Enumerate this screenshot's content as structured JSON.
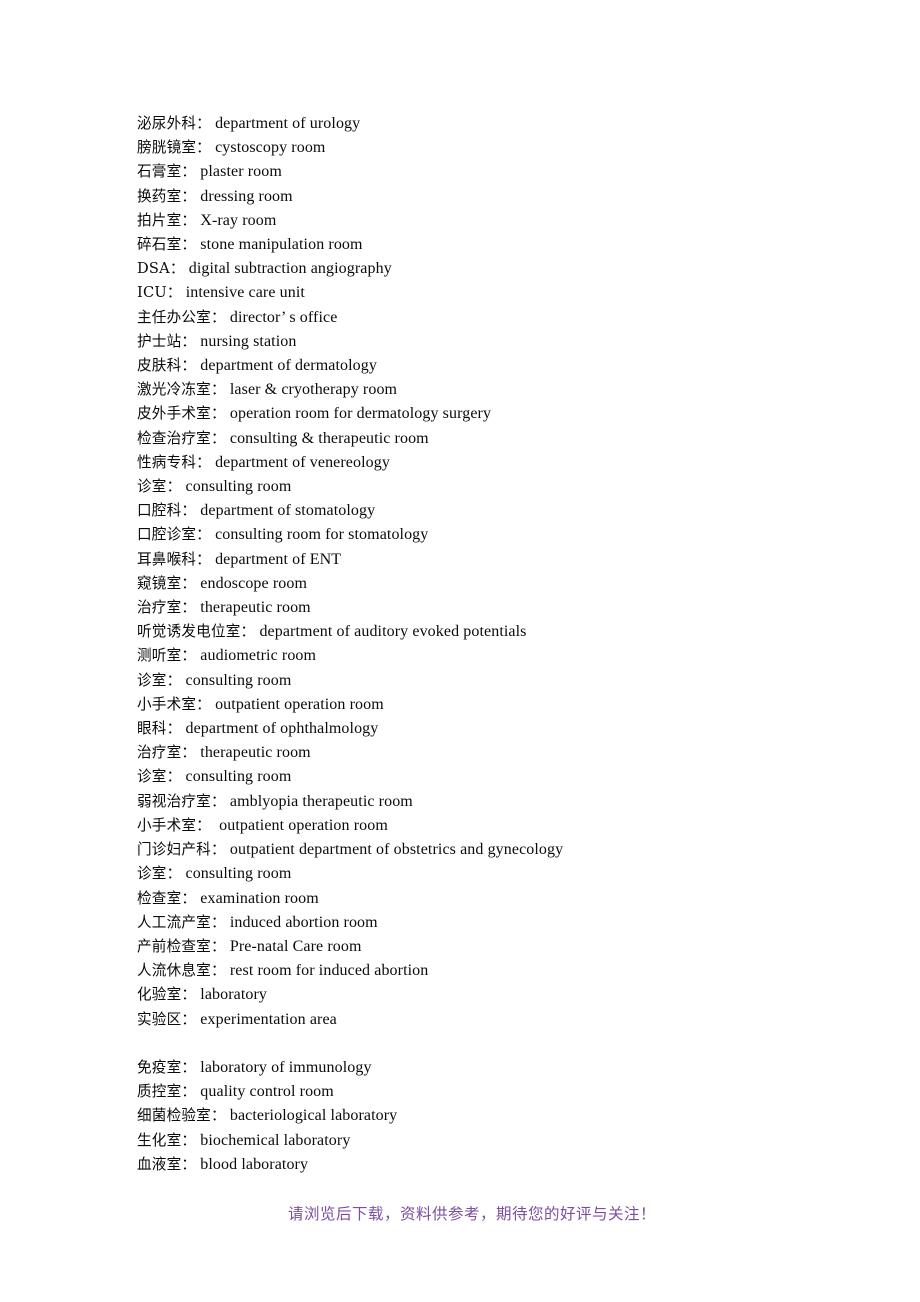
{
  "document": {
    "text_color": "#0b0b0b",
    "footer_color": "#7b4fa0",
    "background_color": "#ffffff"
  },
  "lines": [
    {
      "cn": "泌尿外科：",
      "en": " department of urology"
    },
    {
      "cn": "膀胱镜室：",
      "en": " cystoscopy room"
    },
    {
      "cn": "石膏室：",
      "en": " plaster room"
    },
    {
      "cn": "换药室：",
      "en": " dressing room"
    },
    {
      "cn": "拍片室：",
      "en": " X-ray room"
    },
    {
      "cn": "碎石室：",
      "en": " stone manipulation room"
    },
    {
      "cn": "DSA：",
      "en": " digital subtraction angiography"
    },
    {
      "cn": "ICU：",
      "en": " intensive care unit"
    },
    {
      "cn": "主任办公室：",
      "en": " director’ s office"
    },
    {
      "cn": "护士站：",
      "en": " nursing station"
    },
    {
      "cn": "皮肤科：",
      "en": " department of dermatology"
    },
    {
      "cn": "激光冷冻室：",
      "en": " laser & cryotherapy room"
    },
    {
      "cn": "皮外手术室：",
      "en": " operation room for dermatology surgery"
    },
    {
      "cn": "检查治疗室：",
      "en": " consulting & therapeutic room"
    },
    {
      "cn": "性病专科：",
      "en": " department of venereology"
    },
    {
      "cn": "诊室：",
      "en": " consulting room"
    },
    {
      "cn": "口腔科：",
      "en": " department of stomatology"
    },
    {
      "cn": "口腔诊室：",
      "en": " consulting room for stomatology"
    },
    {
      "cn": "耳鼻喉科：",
      "en": " department of ENT"
    },
    {
      "cn": "窥镜室：",
      "en": " endoscope room"
    },
    {
      "cn": "治疗室：",
      "en": " therapeutic room"
    },
    {
      "cn": "听觉诱发电位室：",
      "en": " department of auditory evoked potentials"
    },
    {
      "cn": "测听室：",
      "en": " audiometric room"
    },
    {
      "cn": "诊室：",
      "en": " consulting room"
    },
    {
      "cn": "小手术室：",
      "en": " outpatient operation room"
    },
    {
      "cn": "眼科：",
      "en": " department of ophthalmology"
    },
    {
      "cn": "治疗室：",
      "en": " therapeutic room"
    },
    {
      "cn": "诊室：",
      "en": " consulting room"
    },
    {
      "cn": "弱视治疗室：",
      "en": " amblyopia therapeutic room"
    },
    {
      "cn": "小手术室：",
      "en": "  outpatient operation room"
    },
    {
      "cn": "门诊妇产科：",
      "en": " outpatient department of obstetrics and gynecology"
    },
    {
      "cn": "诊室：",
      "en": " consulting room"
    },
    {
      "cn": "检查室：",
      "en": " examination room"
    },
    {
      "cn": "人工流产室：",
      "en": " induced abortion room"
    },
    {
      "cn": "产前检查室：",
      "en": " Pre-natal Care room"
    },
    {
      "cn": "人流休息室：",
      "en": " rest room for induced abortion"
    },
    {
      "cn": "化验室：",
      "en": " laboratory"
    },
    {
      "cn": "实验区：",
      "en": " experimentation area"
    },
    {
      "cn": "",
      "en": ""
    },
    {
      "cn": "免疫室：",
      "en": " laboratory of immunology"
    },
    {
      "cn": "质控室：",
      "en": " quality control room"
    },
    {
      "cn": "细菌检验室：",
      "en": " bacteriological laboratory"
    },
    {
      "cn": "生化室：",
      "en": " biochemical laboratory"
    },
    {
      "cn": "血液室：",
      "en": " blood laboratory"
    }
  ],
  "footer": {
    "text": "请浏览后下载，资料供参考，期待您的好评与关注！"
  }
}
